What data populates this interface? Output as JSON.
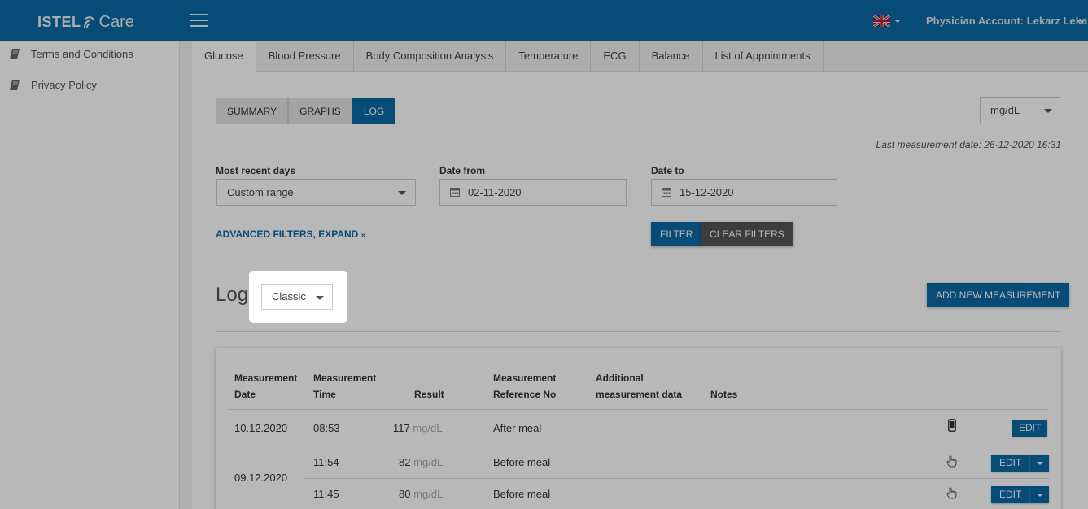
{
  "header": {
    "logo_istel": "ISTEL",
    "logo_care": "Care",
    "account": "Physician Account: Lekarz Leka"
  },
  "sidebar": {
    "items": [
      {
        "label": "Terms and Conditions",
        "icon": "book-icon"
      },
      {
        "label": "Privacy Policy",
        "icon": "book-icon"
      }
    ]
  },
  "tabs": [
    {
      "label": "Glucose",
      "active": true
    },
    {
      "label": "Blood Pressure"
    },
    {
      "label": "Body Composition Analysis"
    },
    {
      "label": "Temperature"
    },
    {
      "label": "ECG"
    },
    {
      "label": "Balance"
    },
    {
      "label": "List of Appointments"
    }
  ],
  "view_switch": {
    "summary": "SUMMARY",
    "graphs": "GRAPHS",
    "log": "LOG",
    "active": "LOG"
  },
  "unit_select": {
    "value": "mg/dL"
  },
  "last_measurement": "Last measurement date: 26-12-2020 16:31",
  "filters": {
    "recent_days_label": "Most recent days",
    "recent_days_value": "Custom range",
    "date_from_label": "Date from",
    "date_from_value": "02-11-2020",
    "date_to_label": "Date to",
    "date_to_value": "15-12-2020",
    "advanced": "ADVANCED FILTERS, EXPAND",
    "filter_btn": "FILTER",
    "clear_btn": "CLEAR FILTERS"
  },
  "log": {
    "title": "Log",
    "mode_value": "Classic",
    "add_btn": "ADD NEW MEASUREMENT"
  },
  "table": {
    "headers": {
      "date_l1": "Measurement",
      "date_l2": "Date",
      "time_l1": "Measurement",
      "time_l2": "Time",
      "result": "Result",
      "ref_l1": "Measurement",
      "ref_l2": "Reference No",
      "add_l1": "Additional",
      "add_l2": "measurement data",
      "notes": "Notes"
    },
    "rows": [
      {
        "date": "10.12.2020",
        "time": "08:53",
        "value": "117",
        "unit": "mg/dL",
        "reference": "After meal",
        "source_icon": "phone-icon",
        "action": "EDIT"
      },
      {
        "date": "09.12.2020",
        "time": "11:54",
        "value": "82",
        "unit": "mg/dL",
        "reference": "Before meal",
        "source_icon": "hand-pointer-icon",
        "action": "EDIT"
      },
      {
        "date": "",
        "time": "11:45",
        "value": "80",
        "unit": "mg/dL",
        "reference": "Before meal",
        "source_icon": "hand-pointer-icon",
        "action": "EDIT"
      }
    ]
  },
  "colors": {
    "primary": "#0a68a6",
    "dark_button": "#555555",
    "overlay": "rgba(0,0,0,0.28)"
  }
}
